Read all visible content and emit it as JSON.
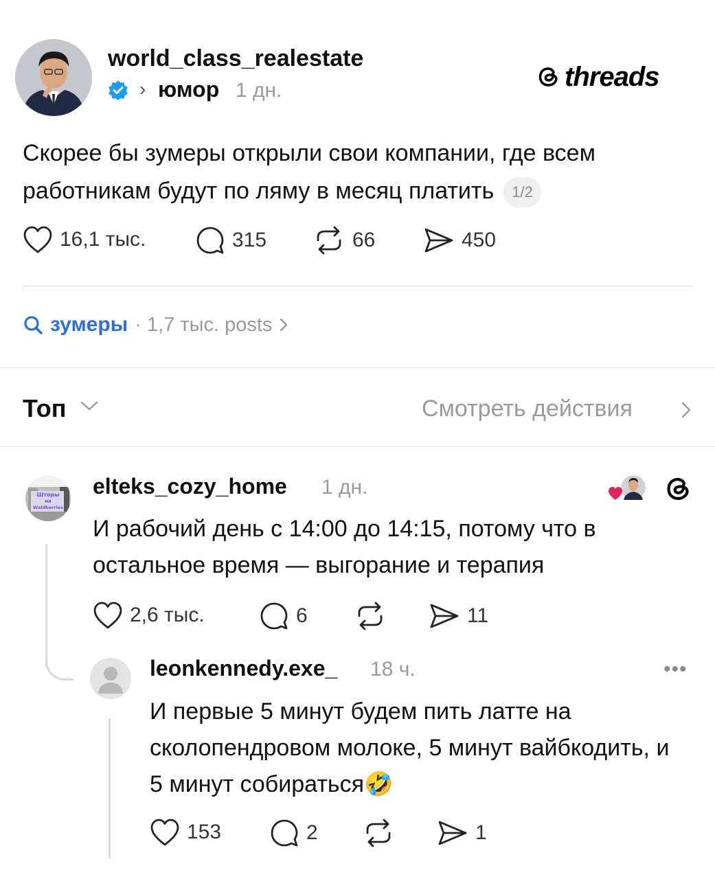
{
  "brand": {
    "name": "threads",
    "logo_icon": "threads-at-icon"
  },
  "post": {
    "username": "world_class_realestate",
    "verified": true,
    "topic": "юмор",
    "time": "1 дн.",
    "text": "Скорее бы зумеры открыли свои компании, где всем работникам будут по ляму в месяц платить",
    "page_indicator": "1/2",
    "likes": "16,1 тыс.",
    "replies": "315",
    "reposts": "66",
    "shares": "450"
  },
  "hashtag": {
    "name": "зумеры",
    "meta": "· 1,7 тыс. posts"
  },
  "sort": {
    "label": "Топ",
    "view_activity": "Смотреть действия"
  },
  "replies": [
    {
      "username": "elteks_cozy_home",
      "time": "1 дн.",
      "avatar_text": [
        "Шторы",
        "на",
        "Waldberries"
      ],
      "text": "И рабочий день с 14:00 до 14:15, потому что в остальное время — выгорание и терапия",
      "likes": "2,6 тыс.",
      "replies": "6",
      "reposts": "",
      "shares": "11"
    },
    {
      "username": "leonkennedy.exe_",
      "time": "18 ч.",
      "more": "•••",
      "text": "И первые 5 минут будем пить латте на сколопендровом молоке, 5 минут вайбкодить, и 5 минут собираться🤣",
      "likes": "153",
      "replies": "2",
      "reposts": "",
      "shares": "1"
    }
  ],
  "colors": {
    "verified": "#1d9bf0",
    "hashtag": "#2f6fd0",
    "muted": "#9a9a9a",
    "like_heart": "#e0245e"
  }
}
